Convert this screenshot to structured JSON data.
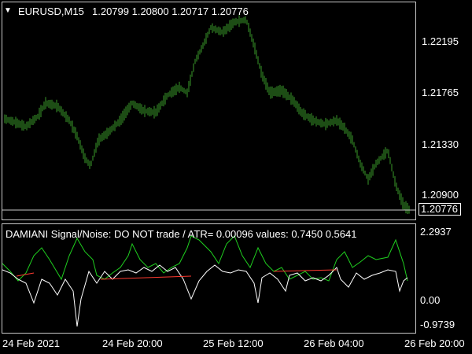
{
  "main": {
    "dropdown_icon": "down-triangle-icon",
    "symbol_label": "EURUSD,M15",
    "ohlc": "1.20799 1.20800 1.20717 1.20776",
    "current_price": "1.20776",
    "price_axis": [
      "1.22195",
      "1.21765",
      "1.21330",
      "1.20900"
    ]
  },
  "indicator": {
    "label": "DAMIANI Signal/Noise: DO NOT trade  /  ATR= 0.00096    values: 0.7450 0.5641",
    "axis": [
      "2.2937",
      "0.00",
      "-0.9739"
    ]
  },
  "time_axis": [
    "24 Feb 2021",
    "24 Feb 20:00",
    "25 Feb 12:00",
    "26 Feb 04:00",
    "26 Feb 20:00"
  ],
  "colors": {
    "candles": "#3a9a2a",
    "green_line": "#1fcf1f",
    "white_line": "#ffffff",
    "red_line": "#ff3b30",
    "frame": "#c8c8c8"
  }
}
